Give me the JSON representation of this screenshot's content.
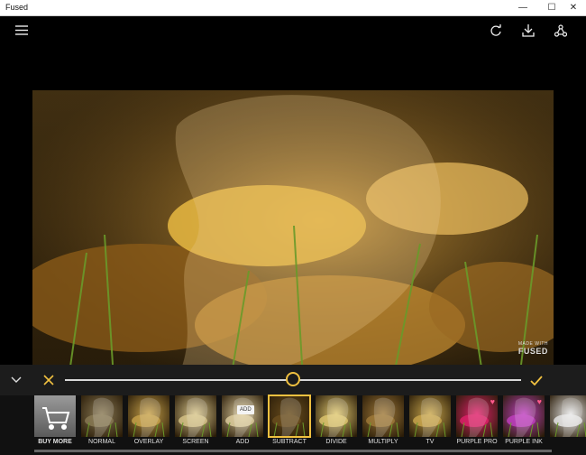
{
  "window": {
    "title": "Fused",
    "minimize_icon": "minimize-icon",
    "maximize_icon": "maximize-icon",
    "close_icon": "close-icon"
  },
  "toolbar": {
    "menu_icon": "hamburger-menu-icon",
    "refresh_icon": "refresh-icon",
    "download_icon": "download-icon",
    "share_icon": "share-icon"
  },
  "watermark": {
    "line1": "MADE WITH",
    "line2": "FUSED"
  },
  "controls": {
    "collapse_icon": "chevron-down-icon",
    "cancel_icon": "close-icon",
    "confirm_icon": "checkmark-icon",
    "opacity_fraction": 0.5,
    "accent_color": "#f0c040"
  },
  "blend_modes": [
    {
      "label": "BUY MORE",
      "bold": true,
      "kind": "cart",
      "color": "#707070"
    },
    {
      "label": "NORMAL",
      "kind": "photo",
      "color": "#8a7a55"
    },
    {
      "label": "OVERLAY",
      "kind": "photo",
      "color": "#c8a24a"
    },
    {
      "label": "SCREEN",
      "kind": "photo",
      "color": "#d8c58a"
    },
    {
      "label": "ADD",
      "kind": "photo",
      "color": "#e0cfa0",
      "badge": "ADD"
    },
    {
      "label": "SUBTRACT",
      "kind": "photo",
      "color": "#6a4e1e",
      "selected": true
    },
    {
      "label": "DIVIDE",
      "kind": "photo",
      "color": "#e0c870"
    },
    {
      "label": "MULTIPLY",
      "kind": "photo",
      "color": "#a07a3a"
    },
    {
      "label": "TV",
      "kind": "photo",
      "color": "#caa84e"
    },
    {
      "label": "PURPLE PRO",
      "kind": "photo",
      "color": "#e0206a",
      "heart": true
    },
    {
      "label": "PURPLE INK",
      "kind": "photo",
      "color": "#c040c0",
      "heart": true
    },
    {
      "label": "",
      "kind": "photo",
      "color": "#e8e8e8"
    }
  ]
}
